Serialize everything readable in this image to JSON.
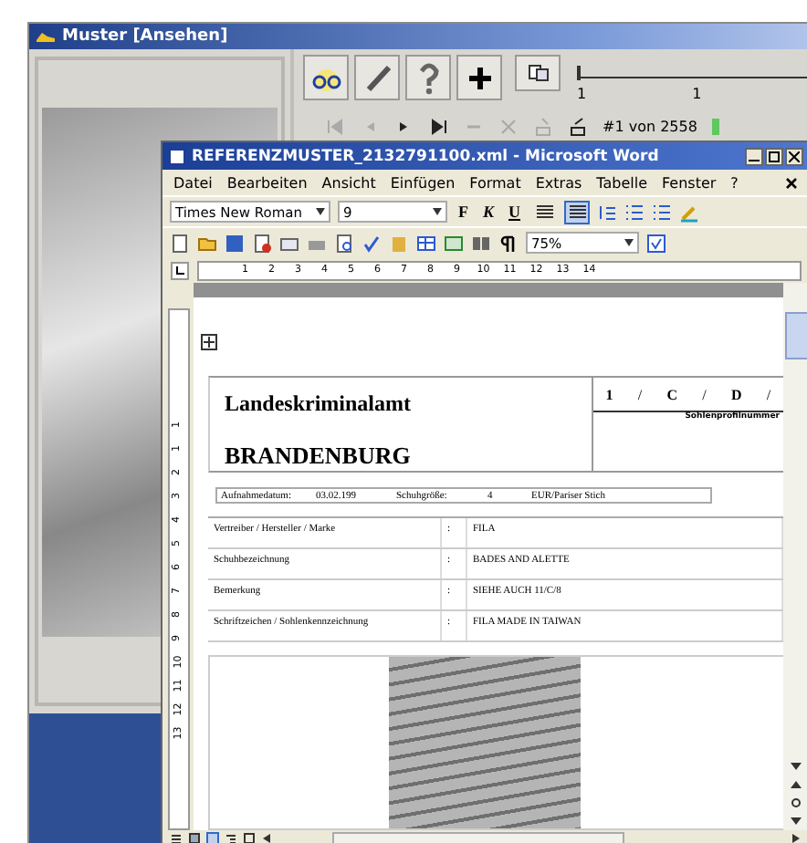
{
  "viewer_window": {
    "title": "Muster [Ansehen]",
    "slider": {
      "level": 0,
      "labels": [
        "1",
        "1"
      ]
    },
    "record": "#1 von 2558"
  },
  "word_window": {
    "title": "REFERENZMUSTER_2132791100.xml - Microsoft Word",
    "menu": [
      "Datei",
      "Bearbeiten",
      "Ansicht",
      "Einfügen",
      "Format",
      "Extras",
      "Tabelle",
      "Fenster",
      "?"
    ],
    "font": "Times New Roman",
    "size": "9",
    "format_buttons": [
      "F",
      "K",
      "U"
    ],
    "align_buttons": [
      {
        "selected": false
      },
      {
        "selected": true
      }
    ],
    "zoom": "75%",
    "ruler": [
      "1",
      "2",
      "3",
      "4",
      "5",
      "6",
      "7",
      "8",
      "9",
      "10",
      "11",
      "12",
      "13",
      "14"
    ],
    "vertical_ruler": [
      "1",
      "1",
      "2",
      "3",
      "4",
      "5",
      "6",
      "7",
      "8",
      "9",
      "10",
      "11",
      "12",
      "13"
    ],
    "document": {
      "heading": "Landeskriminalamt",
      "subheading": "BRANDENBURG",
      "profile_number": [
        "1",
        "C",
        "D"
      ],
      "profile_separator": "/",
      "profile_caption": "Sohlenprofilnummer",
      "info_row": [
        "Aufnahmedatum:",
        "03.02.199",
        "Schuhgröße:",
        "4",
        "EUR/Pariser Stich"
      ],
      "details": [
        {
          "label": "Vertreiber / Hersteller / Marke",
          "separator": ":",
          "value": "FILA"
        },
        {
          "label": "Schuhbezeichnung",
          "separator": ":",
          "value": "BADES AND ALETTE"
        },
        {
          "label": "Bemerkung",
          "separator": ":",
          "value": "SIEHE AUCH 11/C/8"
        },
        {
          "label": "Schriftzeichen / Sohlenkennzeichnung",
          "separator": ":",
          "value": "FILA MADE IN TAIWAN"
        }
      ]
    }
  }
}
